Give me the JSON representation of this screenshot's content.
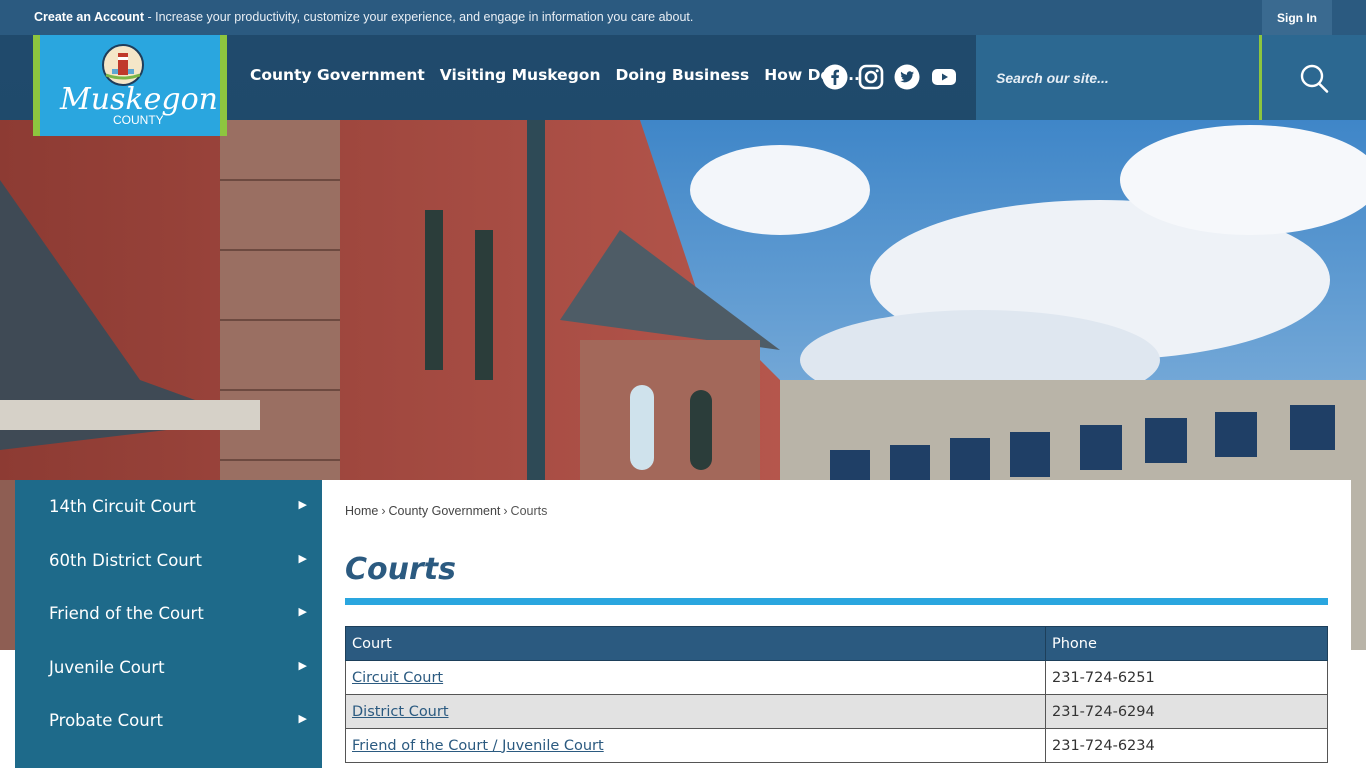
{
  "topbar": {
    "create_account": "Create an Account",
    "message": " - Increase your productivity, customize your experience, and engage in information you care about.",
    "sign_in": "Sign In"
  },
  "logo": {
    "name": "Muskegon",
    "county": "COUNTY"
  },
  "nav": {
    "items": [
      "County Government",
      "Visiting Muskegon",
      "Doing Business",
      "How Do I..."
    ]
  },
  "social": [
    "facebook-icon",
    "instagram-icon",
    "twitter-icon",
    "youtube-icon"
  ],
  "search": {
    "placeholder": "Search our site..."
  },
  "sidebar": {
    "items": [
      {
        "label": "14th Circuit Court"
      },
      {
        "label": "60th District Court"
      },
      {
        "label": "Friend of the Court"
      },
      {
        "label": "Juvenile Court"
      },
      {
        "label": "Probate Court"
      }
    ]
  },
  "breadcrumb": {
    "home": "Home",
    "parent": "County Government",
    "current": "Courts",
    "sep": "›"
  },
  "page": {
    "title": "Courts"
  },
  "table": {
    "headers": [
      "Court",
      "Phone"
    ],
    "rows": [
      {
        "court": "Circuit Court",
        "phone": "231-724-6251"
      },
      {
        "court": "District Court",
        "phone": "231-724-6294"
      },
      {
        "court": "Friend of the Court / Juvenile Court",
        "phone": "231-724-6234"
      }
    ]
  },
  "colors": {
    "header": "#204a6c",
    "accent": "#2aa6df",
    "green": "#8dc63f",
    "sidebar": "#1e6a8a"
  }
}
